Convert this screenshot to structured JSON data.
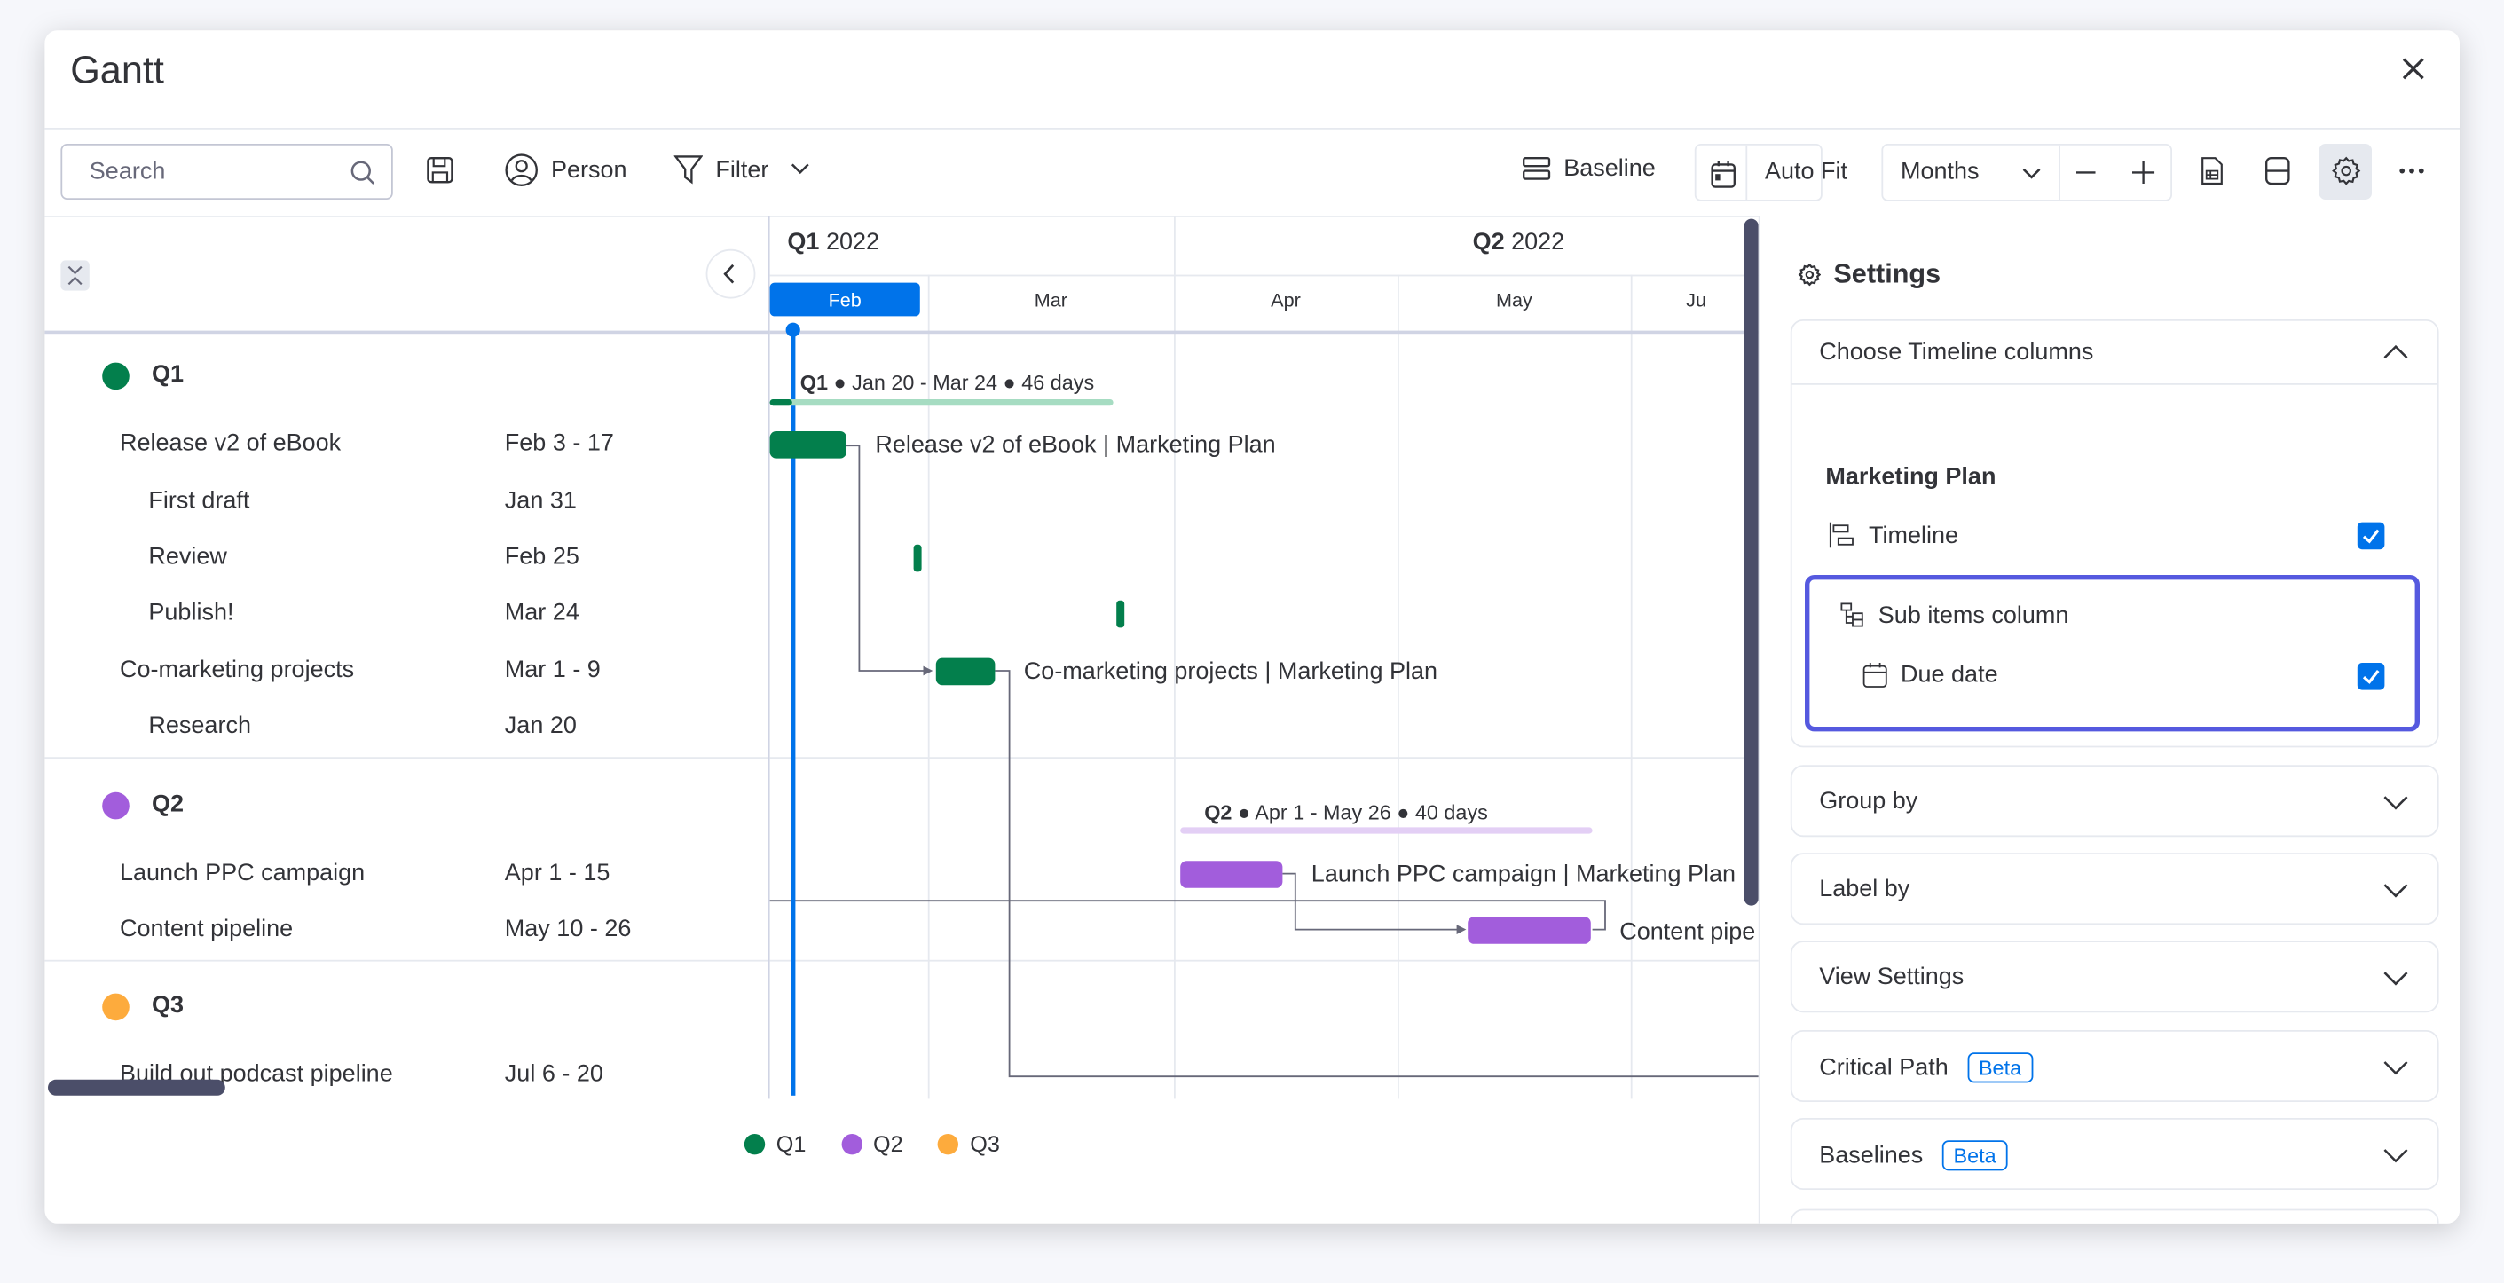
{
  "window": {
    "title": "Gantt"
  },
  "toolbar": {
    "search_placeholder": "Search",
    "person_label": "Person",
    "filter_label": "Filter",
    "baseline_label": "Baseline",
    "autofit_label": "Auto Fit",
    "zoom_select": "Months"
  },
  "timeline": {
    "quarters": [
      {
        "q": "Q1",
        "year": "2022"
      },
      {
        "q": "Q2",
        "year": "2022"
      }
    ],
    "months": [
      "Feb",
      "Mar",
      "Apr",
      "May",
      "Ju"
    ],
    "current_month": "Feb",
    "q1_summary": {
      "name": "Q1",
      "range": "● Jan 20 - Mar 24 ● 46 days"
    },
    "q2_summary": {
      "name": "Q2",
      "range": "● Apr 1 - May 26 ● 40 days"
    },
    "bar_labels": [
      "Release v2 of eBook | Marketing Plan",
      "Co-marketing projects | Marketing Plan",
      "Launch PPC campaign | Marketing Plan",
      "Content pipe"
    ]
  },
  "groups": [
    {
      "name": "Q1",
      "color": "#037f4c",
      "items": [
        {
          "name": "Release v2 of eBook",
          "date": "Feb 3 - 17",
          "sub": false
        },
        {
          "name": "First draft",
          "date": "Jan 31",
          "sub": true
        },
        {
          "name": "Review",
          "date": "Feb 25",
          "sub": true
        },
        {
          "name": "Publish!",
          "date": "Mar 24",
          "sub": true
        },
        {
          "name": "Co-marketing projects",
          "date": "Mar 1 - 9",
          "sub": false
        },
        {
          "name": "Research",
          "date": "Jan 20",
          "sub": true
        }
      ]
    },
    {
      "name": "Q2",
      "color": "#a25ddc",
      "items": [
        {
          "name": "Launch PPC campaign",
          "date": "Apr 1 - 15",
          "sub": false
        },
        {
          "name": "Content pipeline",
          "date": "May 10 - 26",
          "sub": false
        }
      ]
    },
    {
      "name": "Q3",
      "color": "#fdab3d",
      "items": [
        {
          "name": "Build out podcast pipeline",
          "date": "Jul 6 - 20",
          "sub": false
        }
      ]
    }
  ],
  "legend": [
    "Q1",
    "Q2",
    "Q3"
  ],
  "settings": {
    "title": "Settings",
    "timeline_columns": {
      "header": "Choose Timeline columns",
      "board": "Marketing Plan",
      "timeline_label": "Timeline",
      "timeline_checked": true,
      "subitems_label": "Sub items column",
      "due_date_label": "Due date",
      "due_date_checked": true
    },
    "sections": [
      {
        "label": "Group by",
        "badge": ""
      },
      {
        "label": "Label by",
        "badge": ""
      },
      {
        "label": "View Settings",
        "badge": ""
      },
      {
        "label": "Critical Path",
        "badge": "Beta"
      },
      {
        "label": "Baselines",
        "badge": "Beta"
      }
    ]
  },
  "colors": {
    "accent": "#0073ea",
    "q1": "#037f4c",
    "q2": "#a25ddc",
    "q3": "#fdab3d",
    "highlight": "#5559df"
  }
}
